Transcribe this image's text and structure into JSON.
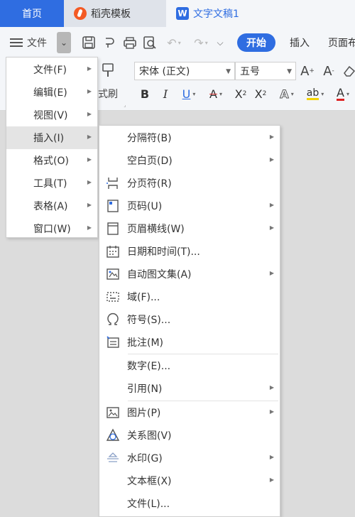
{
  "tabs": {
    "home": "首页",
    "docer": "稻壳模板",
    "doc": "文字文稿1"
  },
  "toolbar": {
    "file_label": "文件",
    "start": "开始",
    "insert": "插入",
    "page_partial": "页面布"
  },
  "ribbon": {
    "format_painter_partial": "式刷",
    "font": "宋体 (正文)",
    "size": "五号"
  },
  "colors": {
    "accent": "#2f6de1",
    "tab_bar": "#dfe3ea",
    "menu_active": "#e4e4e4"
  },
  "file_menu": [
    {
      "label": "文件(F)"
    },
    {
      "label": "编辑(E)"
    },
    {
      "label": "视图(V)"
    },
    {
      "label": "插入(I)",
      "active": true
    },
    {
      "label": "格式(O)"
    },
    {
      "label": "工具(T)"
    },
    {
      "label": "表格(A)"
    },
    {
      "label": "窗口(W)"
    }
  ],
  "insert_menu": [
    {
      "label": "分隔符(B)",
      "icon": "none",
      "submenu": true
    },
    {
      "label": "空白页(D)",
      "icon": "none",
      "submenu": true
    },
    {
      "label": "分页符(R)",
      "icon": "page-break-icon",
      "submenu": false
    },
    {
      "label": "页码(U)",
      "icon": "page-number-icon",
      "submenu": true
    },
    {
      "label": "页眉横线(W)",
      "icon": "header-line-icon",
      "submenu": true
    },
    {
      "label": "日期和时间(T)...",
      "icon": "calendar-icon",
      "submenu": false
    },
    {
      "label": "自动图文集(A)",
      "icon": "autotext-icon",
      "submenu": true
    },
    {
      "label": "域(F)...",
      "icon": "field-icon",
      "submenu": false
    },
    {
      "label": "符号(S)...",
      "icon": "omega-icon",
      "submenu": false
    },
    {
      "label": "批注(M)",
      "icon": "comment-icon",
      "submenu": false
    },
    {
      "label": "数字(E)...",
      "icon": "none",
      "submenu": false
    },
    {
      "label": "引用(N)",
      "icon": "none",
      "submenu": true
    },
    {
      "label": "图片(P)",
      "icon": "picture-icon",
      "submenu": true
    },
    {
      "label": "关系图(V)",
      "icon": "relation-icon",
      "submenu": false
    },
    {
      "label": "水印(G)",
      "icon": "watermark-icon",
      "submenu": true
    },
    {
      "label": "文本框(X)",
      "icon": "none",
      "submenu": true
    },
    {
      "label": "文件(L)...",
      "icon": "none",
      "submenu": false
    }
  ]
}
